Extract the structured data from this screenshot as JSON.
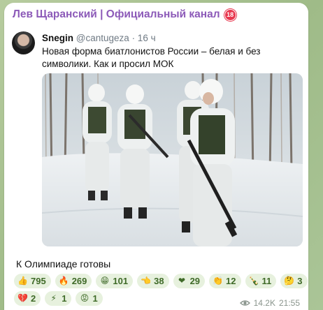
{
  "channel": {
    "name": "Лев Щаранский | Официальный канал",
    "age_badge": "18"
  },
  "tweet": {
    "author": "Snegin",
    "handle": "@cantugeza",
    "time": "· 16 ч",
    "text": "Новая форма биатлонистов России – белая и без символики. Как и просил МОК"
  },
  "caption": "К Олимпиаде готовы",
  "reactions": [
    {
      "icon": "thumbs-up",
      "emoji": "👍",
      "count": "795"
    },
    {
      "icon": "fire",
      "emoji": "🔥",
      "count": "269"
    },
    {
      "icon": "grinning-face",
      "emoji": "😁",
      "count": "101"
    },
    {
      "icon": "pointing-hand",
      "emoji": "👈",
      "count": "38"
    },
    {
      "icon": "heart",
      "emoji": "❤",
      "count": "29"
    },
    {
      "icon": "clapping-hands",
      "emoji": "👏",
      "count": "12"
    },
    {
      "icon": "champagne",
      "emoji": "🍾",
      "count": "11"
    },
    {
      "icon": "thinking-face",
      "emoji": "🤔",
      "count": "3"
    },
    {
      "icon": "broken-heart",
      "emoji": "💔",
      "count": "2"
    },
    {
      "icon": "lightning",
      "emoji": "⚡",
      "count": "1"
    },
    {
      "icon": "angry-face",
      "emoji": "😡",
      "count": "1"
    }
  ],
  "meta": {
    "views": "14.2K",
    "time": "21:55"
  },
  "colors": {
    "channel_name": "#8c5ab8",
    "reaction_bg": "#e7f1de",
    "reaction_text": "#3f6a28",
    "wallpaper": "#a9c294"
  }
}
